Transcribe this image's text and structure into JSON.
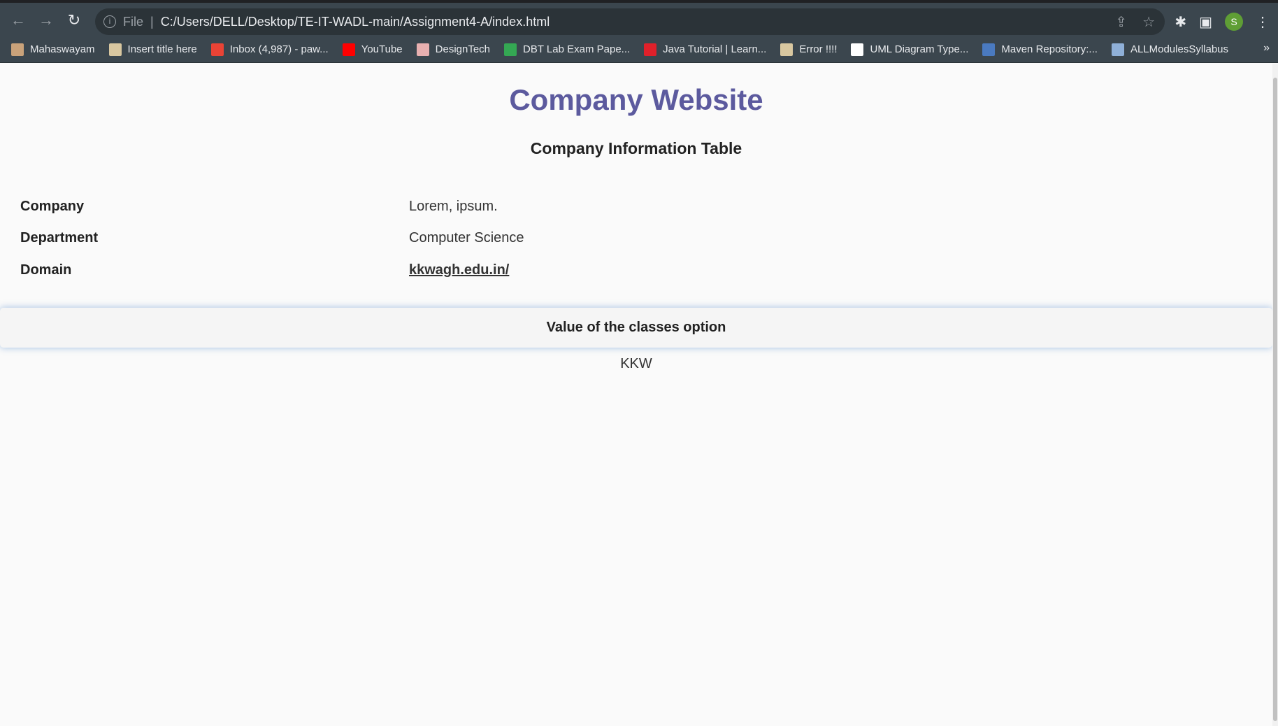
{
  "browser": {
    "url_scheme": "File",
    "url": "C:/Users/DELL/Desktop/TE-IT-WADL-main/Assignment4-A/index.html",
    "profile_initial": "S",
    "bookmarks": [
      {
        "label": "Mahaswayam",
        "color": "#c9a27a"
      },
      {
        "label": "Insert title here",
        "color": "#d8c7a0"
      },
      {
        "label": "Inbox (4,987) - paw...",
        "color": "#ea4335"
      },
      {
        "label": "YouTube",
        "color": "#ff0000"
      },
      {
        "label": "DesignTech",
        "color": "#e8b0b0"
      },
      {
        "label": "DBT Lab Exam Pape...",
        "color": "#34a853"
      },
      {
        "label": "Java Tutorial | Learn...",
        "color": "#e0202a"
      },
      {
        "label": "Error !!!!",
        "color": "#d8c7a0"
      },
      {
        "label": "UML Diagram Type...",
        "color": "#ffffff"
      },
      {
        "label": "Maven Repository:...",
        "color": "#4a7ac0"
      },
      {
        "label": "ALLModulesSyllabus",
        "color": "#8fb0d8"
      }
    ],
    "more": "»"
  },
  "page": {
    "title": "Company Website",
    "subtitle": "Company Information Table",
    "rows": [
      {
        "label": "Company",
        "value": "Lorem, ipsum."
      },
      {
        "label": "Department",
        "value": "Computer Science"
      },
      {
        "label": "Domain",
        "value": " kkwagh.edu.in/"
      }
    ],
    "panel_title": "Value of the classes option",
    "panel_value": "KKW"
  }
}
